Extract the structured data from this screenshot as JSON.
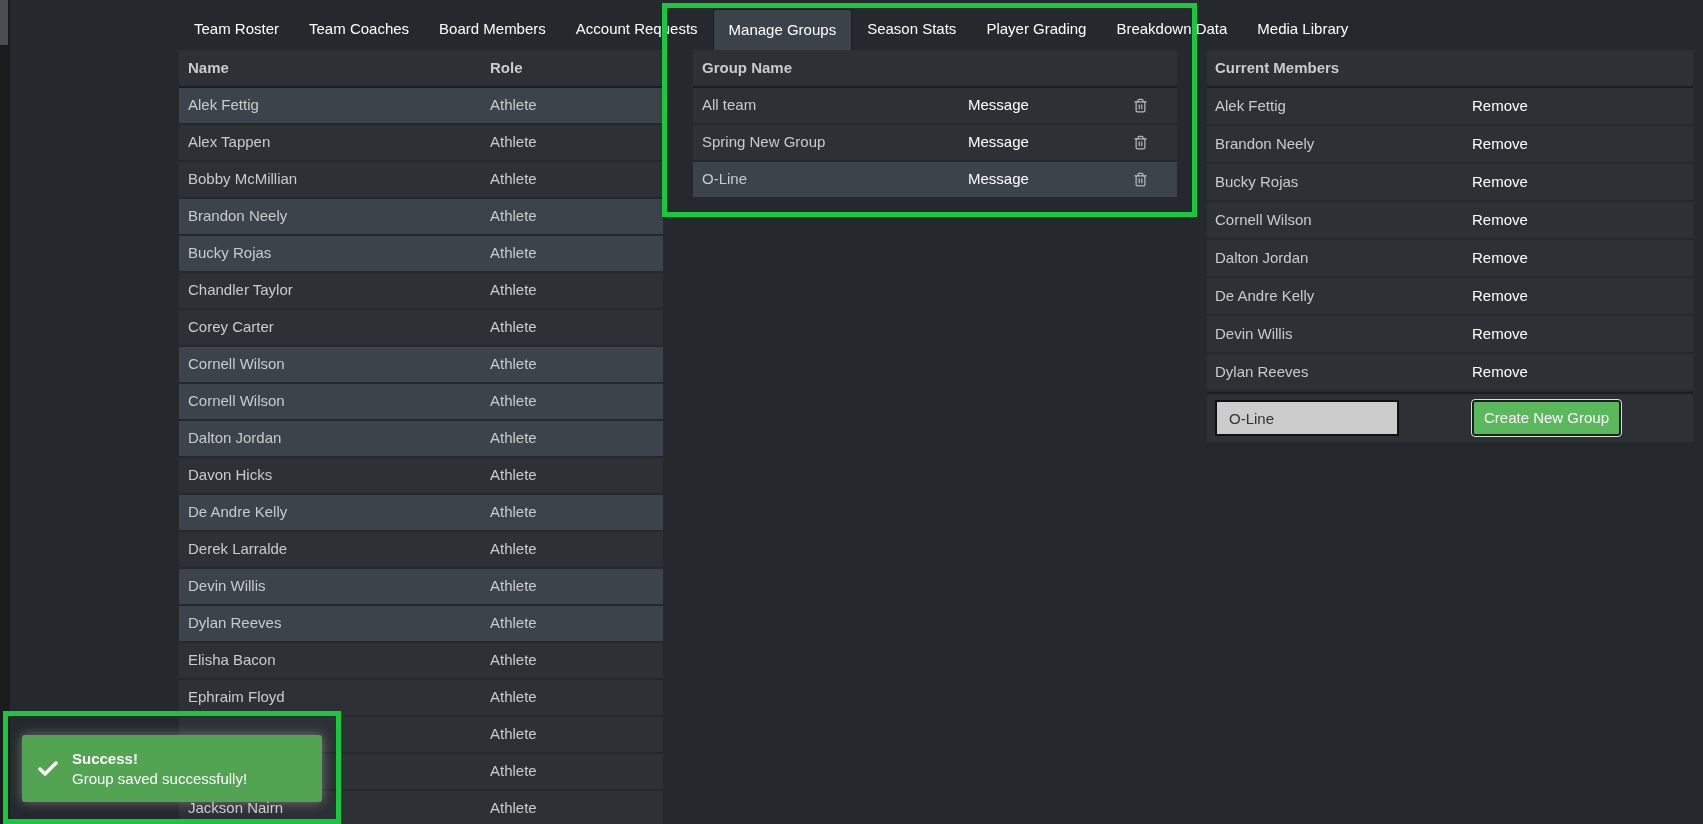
{
  "tabs": [
    {
      "label": "Team Roster",
      "selected": false
    },
    {
      "label": "Team Coaches",
      "selected": false
    },
    {
      "label": "Board Members",
      "selected": false
    },
    {
      "label": "Account Requests",
      "selected": false
    },
    {
      "label": "Manage Groups",
      "selected": true
    },
    {
      "label": "Season Stats",
      "selected": false
    },
    {
      "label": "Player Grading",
      "selected": false
    },
    {
      "label": "Breakdown Data",
      "selected": false
    },
    {
      "label": "Media Library",
      "selected": false
    }
  ],
  "roster": {
    "columns": [
      "Name",
      "Role"
    ],
    "rows": [
      {
        "name": "Alek Fettig",
        "role": "Athlete",
        "selected": true
      },
      {
        "name": "Alex Tappen",
        "role": "Athlete",
        "selected": false
      },
      {
        "name": "Bobby McMillian",
        "role": "Athlete",
        "selected": false
      },
      {
        "name": "Brandon Neely",
        "role": "Athlete",
        "selected": true
      },
      {
        "name": "Bucky Rojas",
        "role": "Athlete",
        "selected": true
      },
      {
        "name": "Chandler Taylor",
        "role": "Athlete",
        "selected": false
      },
      {
        "name": "Corey Carter",
        "role": "Athlete",
        "selected": false
      },
      {
        "name": "Cornell Wilson",
        "role": "Athlete",
        "selected": true
      },
      {
        "name": "Cornell Wilson",
        "role": "Athlete",
        "selected": true
      },
      {
        "name": "Dalton Jordan",
        "role": "Athlete",
        "selected": true
      },
      {
        "name": "Davon Hicks",
        "role": "Athlete",
        "selected": false
      },
      {
        "name": "De Andre Kelly",
        "role": "Athlete",
        "selected": true
      },
      {
        "name": "Derek Larralde",
        "role": "Athlete",
        "selected": false
      },
      {
        "name": "Devin Willis",
        "role": "Athlete",
        "selected": true
      },
      {
        "name": "Dylan Reeves",
        "role": "Athlete",
        "selected": true
      },
      {
        "name": "Elisha Bacon",
        "role": "Athlete",
        "selected": false
      },
      {
        "name": "Ephraim Floyd",
        "role": "Athlete",
        "selected": false
      },
      {
        "role": "Athlete",
        "selected": false
      },
      {
        "role": "Athlete",
        "selected": false
      },
      {
        "name": "Jackson Nairn",
        "role": "Athlete",
        "selected": false
      }
    ]
  },
  "groups": {
    "columns": [
      "Group Name"
    ],
    "rows": [
      {
        "name": "All team",
        "action": "Message",
        "selected": false
      },
      {
        "name": "Spring New Group",
        "action": "Message",
        "selected": false
      },
      {
        "name": "O-Line",
        "action": "Message",
        "selected": true
      }
    ]
  },
  "members": {
    "columns": [
      "Current Members"
    ],
    "rows": [
      {
        "name": "Alek Fettig",
        "action": "Remove"
      },
      {
        "name": "Brandon Neely",
        "action": "Remove"
      },
      {
        "name": "Bucky Rojas",
        "action": "Remove"
      },
      {
        "name": "Cornell Wilson",
        "action": "Remove"
      },
      {
        "name": "Dalton Jordan",
        "action": "Remove"
      },
      {
        "name": "De Andre Kelly",
        "action": "Remove"
      },
      {
        "name": "Devin Willis",
        "action": "Remove"
      },
      {
        "name": "Dylan Reeves",
        "action": "Remove"
      }
    ],
    "group_name_input": {
      "value": "O-Line"
    },
    "create_button": "Create New Group"
  },
  "toast": {
    "title": "Success!",
    "message": "Group saved successfully!"
  }
}
